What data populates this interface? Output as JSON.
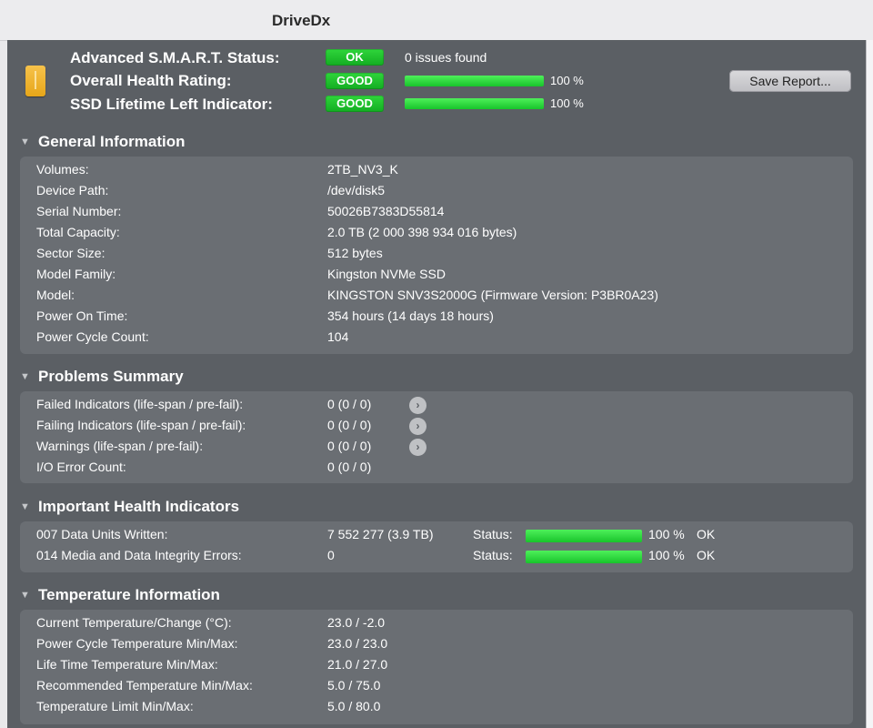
{
  "window": {
    "title": "DriveDx"
  },
  "header": {
    "smart_label": "Advanced S.M.A.R.T. Status:",
    "smart_badge": "OK",
    "smart_text": "0 issues found",
    "health_label": "Overall Health Rating:",
    "health_badge": "GOOD",
    "health_pct": "100 %",
    "health_fill": 1.0,
    "ssd_label": "SSD Lifetime Left Indicator:",
    "ssd_badge": "GOOD",
    "ssd_pct": "100 %",
    "ssd_fill": 1.0,
    "save_label": "Save Report...",
    "accent": "#1fbf2e"
  },
  "general": {
    "title": "General Information",
    "rows": [
      {
        "k": "Volumes:",
        "v": "2TB_NV3_K"
      },
      {
        "k": "Device Path:",
        "v": "/dev/disk5"
      },
      {
        "k": "Serial Number:",
        "v": "50026B7383D55814"
      },
      {
        "k": "Total Capacity:",
        "v": "2.0 TB (2 000 398 934 016 bytes)"
      },
      {
        "k": "Sector Size:",
        "v": "512 bytes"
      },
      {
        "k": "Model Family:",
        "v": "Kingston NVMe SSD"
      },
      {
        "k": "Model:",
        "v": "KINGSTON SNV3S2000G  (Firmware Version: P3BR0A23)"
      },
      {
        "k": "Power On Time:",
        "v": "354 hours (14 days 18 hours)"
      },
      {
        "k": "Power Cycle Count:",
        "v": "104"
      }
    ]
  },
  "problems": {
    "title": "Problems Summary",
    "rows": [
      {
        "k": "Failed Indicators (life-span / pre-fail):",
        "v": "0  (0 / 0)"
      },
      {
        "k": "Failing Indicators (life-span / pre-fail):",
        "v": "0  (0 / 0)"
      },
      {
        "k": "Warnings (life-span / pre-fail):",
        "v": "0  (0 / 0)"
      },
      {
        "k": "I/O Error Count:",
        "v": "0  (0 / 0)"
      }
    ],
    "arrow_glyph": "›"
  },
  "health": {
    "title": "Important Health Indicators",
    "status_label": "Status:",
    "rows": [
      {
        "k": "007  Data Units Written:",
        "v": "7 552 277 (3.9 TB)",
        "pct": "100 %",
        "ok": "OK",
        "fill": 1.0
      },
      {
        "k": "014  Media and Data Integrity Errors:",
        "v": "0",
        "pct": "100 %",
        "ok": "OK",
        "fill": 1.0
      }
    ]
  },
  "temperature": {
    "title": "Temperature Information",
    "rows": [
      {
        "k": "Current Temperature/Change (°C):",
        "v": "23.0 / -2.0"
      },
      {
        "k": "Power Cycle Temperature Min/Max:",
        "v": "23.0 / 23.0"
      },
      {
        "k": "Life Time Temperature Min/Max:",
        "v": "21.0 / 27.0"
      },
      {
        "k": "Recommended Temperature Min/Max:",
        "v": "5.0   / 75.0"
      },
      {
        "k": "Temperature Limit Min/Max:",
        "v": "5.0   / 80.0"
      }
    ]
  },
  "section_toggle_glyph": "▼"
}
